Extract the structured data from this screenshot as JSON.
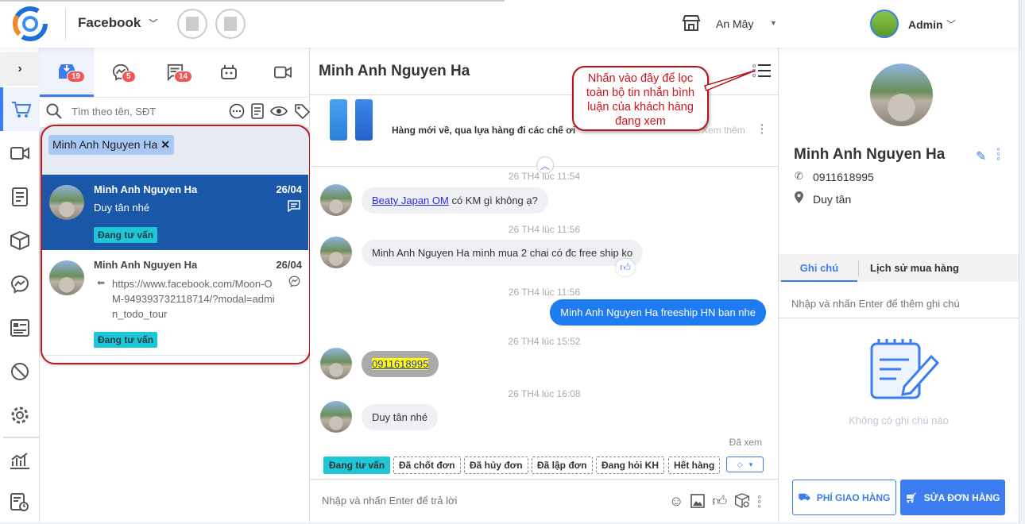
{
  "header": {
    "channel": "Facebook",
    "store": "An Mây",
    "user": "Admin"
  },
  "sidebar": {
    "items": [
      "expand",
      "cart",
      "video",
      "orders",
      "products",
      "messenger",
      "contacts",
      "blocked",
      "settings",
      "reports",
      "history"
    ]
  },
  "list": {
    "tabs": [
      {
        "icon": "inbox-icon",
        "badge": "19"
      },
      {
        "icon": "messenger-icon",
        "badge": "5"
      },
      {
        "icon": "comment-icon",
        "badge": "14"
      },
      {
        "icon": "bot-icon",
        "badge": ""
      },
      {
        "icon": "video-icon",
        "badge": ""
      }
    ],
    "search_placeholder": "Tìm theo tên, SĐT",
    "filter_chip": "Minh Anh Nguyen Ha",
    "conversations": [
      {
        "name": "Minh Anh Nguyen Ha",
        "date": "26/04",
        "preview": "Duy tân nhé",
        "tag": "Đang tư vấn"
      },
      {
        "name": "Minh Anh Nguyen Ha",
        "date": "26/04",
        "preview": "https://www.facebook.com/Moon-OM-949393732118714/?modal=admin_todo_tour",
        "tag": "Đang tư vấn"
      }
    ]
  },
  "chat": {
    "title": "Minh Anh Nguyen Ha",
    "tooltip": "Nhấn vào đây để lọc toàn bộ tin nhắn bình luận của khách hàng đang xem",
    "post": {
      "text": "Hàng mới về, qua lựa hàng đi các chế ơi",
      "more": "Xem thêm"
    },
    "messages": [
      {
        "time": "26 TH4 lúc 11:54",
        "link": "Beaty Japan OM",
        "text": "có KM gì không ạ?"
      },
      {
        "time": "26 TH4 lúc 11:56",
        "text": "Minh Anh Nguyen Ha mình mua 2 chai có đc free ship ko"
      },
      {
        "time": "26 TH4 lúc 11:56",
        "text": "Minh Anh Nguyen Ha freeship HN ban nhe"
      },
      {
        "time": "26 TH4 lúc 15:52",
        "text": "0911618995"
      },
      {
        "time": "26 TH4 lúc 16:08",
        "text": "Duy tân nhé"
      }
    ],
    "seen": "Đã xem",
    "quick_tags": [
      "Đang tư vấn",
      "Đã chốt đơn",
      "Đã hủy đơn",
      "Đã lập đơn",
      "Đang hỏi KH",
      "Hết hàng"
    ],
    "input_placeholder": "Nhập và nhấn Enter để trả lời"
  },
  "customer": {
    "name": "Minh Anh Nguyen Ha",
    "phone": "0911618995",
    "address": "Duy tân",
    "tabs": [
      "Ghi chú",
      "Lịch sử mua hàng"
    ],
    "note_placeholder": "Nhập và nhấn Enter để thêm ghi chú",
    "empty": "Không có ghi chú nào",
    "shipping_btn": "PHÍ GIAO HÀNG",
    "order_btn": "SỬA ĐƠN HÀNG"
  },
  "colors": {
    "primary": "#3b7cf0",
    "selected": "#1a57a8",
    "tag": "#1fc6d6"
  }
}
